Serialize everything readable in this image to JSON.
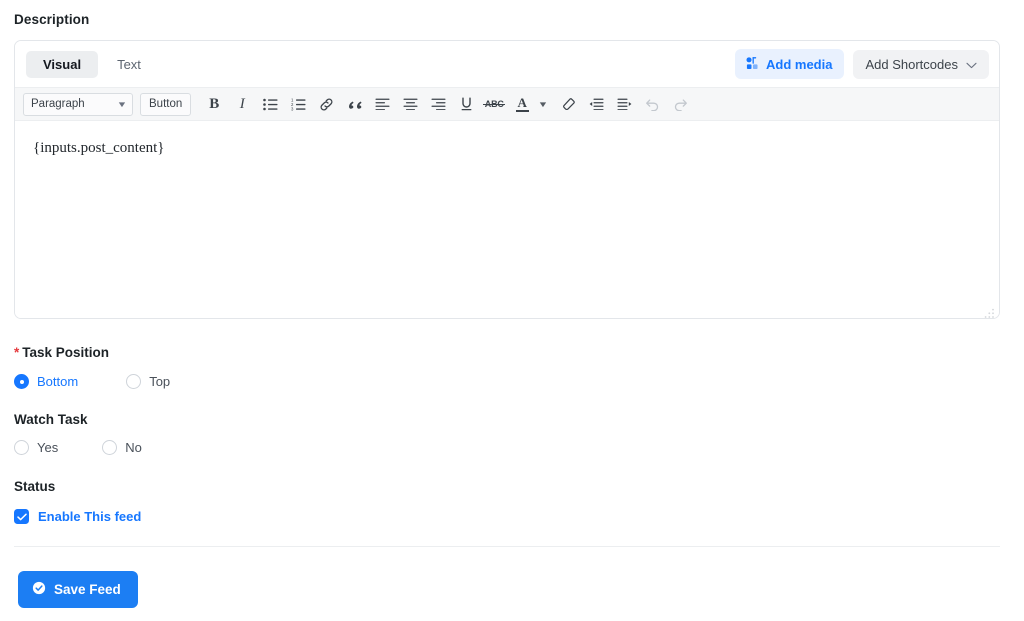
{
  "description": {
    "label": "Description"
  },
  "editor": {
    "tabs": [
      {
        "label": "Visual",
        "active": true
      },
      {
        "label": "Text",
        "active": false
      }
    ],
    "add_media_label": "Add media",
    "add_shortcodes_label": "Add Shortcodes",
    "toolbar": {
      "format_select": "Paragraph",
      "button_label": "Button",
      "icons": [
        "bold-icon",
        "italic-icon",
        "bulleted-list-icon",
        "numbered-list-icon",
        "link-icon",
        "blockquote-icon",
        "align-left-icon",
        "align-center-icon",
        "align-right-icon",
        "underline-icon",
        "strikethrough-icon",
        "text-color-icon",
        "clear-formatting-icon",
        "decrease-indent-icon",
        "increase-indent-icon",
        "undo-icon",
        "redo-icon"
      ]
    },
    "content": "{inputs.post_content}"
  },
  "task_position": {
    "label": "Task Position",
    "required_marker": "*",
    "options": [
      {
        "label": "Bottom",
        "selected": true
      },
      {
        "label": "Top",
        "selected": false
      }
    ]
  },
  "watch_task": {
    "label": "Watch Task",
    "options": [
      {
        "label": "Yes",
        "selected": false
      },
      {
        "label": "No",
        "selected": false
      }
    ]
  },
  "status": {
    "label": "Status",
    "checkbox_label": "Enable This feed",
    "checked": true
  },
  "footer": {
    "save_label": "Save Feed"
  },
  "colors": {
    "accent_blue": "#1677ff",
    "save_button_blue": "#1c7ef3",
    "add_media_bg": "#e9f1fe",
    "required_red": "#e5393d",
    "toolbar_bg": "#f6f7f8"
  }
}
